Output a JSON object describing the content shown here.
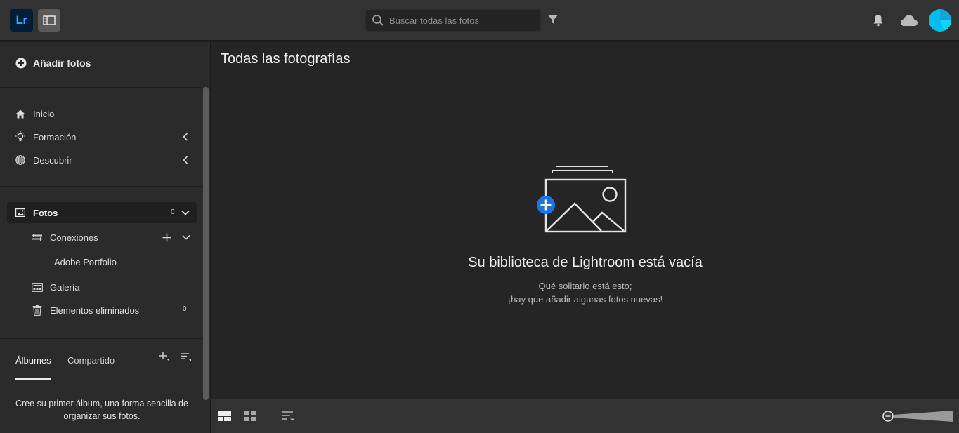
{
  "app": {
    "logo_text": "Lr",
    "accent_color": "#31a8ff",
    "avatar_color": "#00c0ef"
  },
  "topbar": {
    "search_placeholder": "Buscar todas las fotos",
    "icons": [
      "panel-toggle-icon",
      "search-icon",
      "filter-icon",
      "bell-icon",
      "cloud-icon",
      "avatar"
    ]
  },
  "sidebar": {
    "add_photos_label": "Añadir fotos",
    "nav": [
      {
        "label": "Inicio",
        "icon": "home-icon"
      },
      {
        "label": "Formación",
        "icon": "lightbulb-icon"
      },
      {
        "label": "Descubrir",
        "icon": "globe-icon"
      }
    ],
    "library": {
      "photos_label": "Fotos",
      "photos_count": "0",
      "connections_label": "Conexiones",
      "portfolio_label": "Adobe Portfolio",
      "gallery_label": "Galería",
      "deleted_label": "Elementos eliminados",
      "deleted_count": "0"
    },
    "albums": {
      "tab_albums": "Álbumes",
      "tab_shared": "Compartido",
      "hint": "Cree su primer álbum, una forma sencilla de organizar sus fotos."
    }
  },
  "main": {
    "title": "Todas las fotografías",
    "empty_title": "Su biblioteca de Lightroom está vacía",
    "empty_line1": "Qué solitario está esto;",
    "empty_line2": "¡hay que añadir algunas fotos nuevas!"
  },
  "bottombar": {
    "icons": [
      "grid-large-icon",
      "grid-small-icon",
      "sort-icon",
      "zoom-slider"
    ]
  }
}
